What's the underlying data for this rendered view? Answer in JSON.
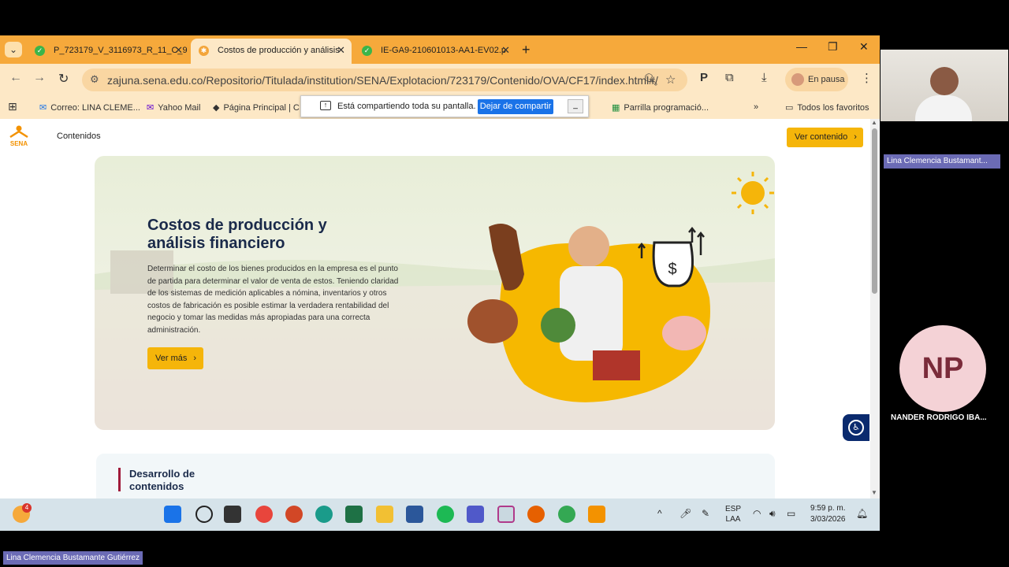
{
  "tabs": [
    {
      "label": "P_723179_V_3116973_R_11_C_9"
    },
    {
      "label": "Costos de producción y análisis"
    },
    {
      "label": "IE-GA9-210601013-AA1-EV02.p"
    }
  ],
  "address": {
    "url": "zajuna.sena.edu.co/Repositorio/Titulada/institution/SENA/Explotacion/723179/Contenido/OVA/CF17/index.html#/"
  },
  "profile": {
    "label": "En pausa"
  },
  "bookmarks": [
    {
      "label": "Correo: LINA CLEME..."
    },
    {
      "label": "Yahoo Mail"
    },
    {
      "label": "Página Principal | C"
    },
    {
      "label": "Parrilla programació..."
    },
    {
      "label": "»"
    },
    {
      "label": "Todos los favoritos"
    }
  ],
  "share_bar": {
    "text": "Está compartiendo toda su pantalla.",
    "stop_label": "Dejar de compartir",
    "min_label": "_"
  },
  "page": {
    "menu_label": "Contenidos",
    "ver_contenido": "Ver contenido",
    "hero": {
      "title": "Costos de producción y análisis financiero",
      "text": "Determinar el costo de los bienes producidos en la empresa es el punto de partida para determinar el valor de venta de estos. Teniendo claridad de los sistemas de medición aplicables a nómina, inventarios y otros costos de fabricación es posible estimar la verdadera rentabilidad del negocio y tomar las medidas más apropiadas para una correcta administración.",
      "button": "Ver más"
    },
    "section_title": "Desarrollo de contenidos"
  },
  "taskbar": {
    "lang_line1": "ESP",
    "lang_line2": "LAA",
    "time": "9:59 p. m.",
    "date": "3/03/2026",
    "weather_badge": "4"
  },
  "meeting": {
    "cam_name": "Lina Clemencia Bustamant...",
    "np_initials": "NP",
    "np_name": "NANDER RODRIGO IBA...",
    "bottom_name": "Lina Clemencia Bustamante Gutiérrez"
  },
  "colors": {
    "tabbar": "#f6a93b",
    "accent_yellow": "#f5b50a",
    "title_navy": "#1a2a4a",
    "share_blue": "#1a73e8"
  }
}
